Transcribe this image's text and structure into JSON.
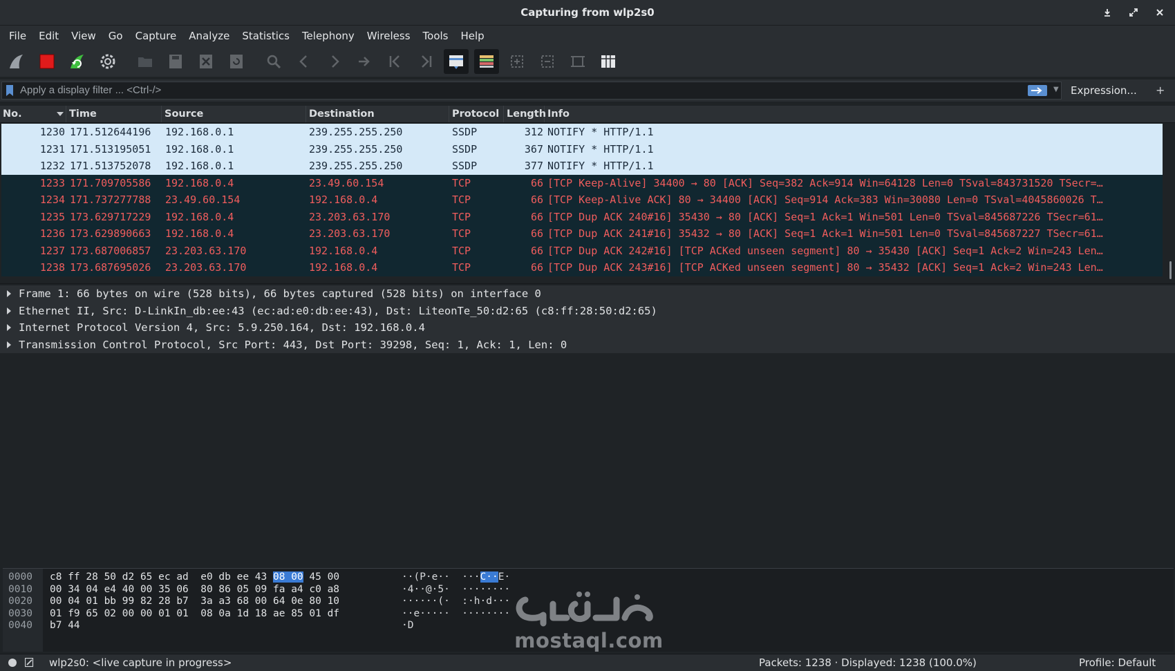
{
  "window": {
    "title": "Capturing from wlp2s0"
  },
  "menu": [
    "File",
    "Edit",
    "View",
    "Go",
    "Capture",
    "Analyze",
    "Statistics",
    "Telephony",
    "Wireless",
    "Tools",
    "Help"
  ],
  "toolbar": [
    {
      "icon": "shark-fin-start-icon"
    },
    {
      "icon": "stop-capture-icon"
    },
    {
      "icon": "restart-capture-icon"
    },
    {
      "icon": "capture-options-gear-icon"
    },
    {
      "icon": "open-file-icon"
    },
    {
      "icon": "save-file-icon"
    },
    {
      "icon": "close-file-icon"
    },
    {
      "icon": "reload-file-icon"
    },
    {
      "icon": "find-packet-icon"
    },
    {
      "icon": "go-back-icon"
    },
    {
      "icon": "go-forward-icon"
    },
    {
      "icon": "go-to-packet-icon"
    },
    {
      "icon": "go-first-icon"
    },
    {
      "icon": "go-last-icon"
    },
    {
      "icon": "autoscroll-icon"
    },
    {
      "icon": "colorize-icon"
    },
    {
      "icon": "zoom-in-icon"
    },
    {
      "icon": "zoom-out-icon"
    },
    {
      "icon": "normal-size-icon"
    },
    {
      "icon": "resize-columns-icon"
    }
  ],
  "filter": {
    "placeholder": "Apply a display filter ... <Ctrl-/>",
    "expression_label": "Expression...",
    "plus_label": "+"
  },
  "columns": [
    "No.",
    "Time",
    "Source",
    "Destination",
    "Protocol",
    "Length",
    "Info"
  ],
  "packets": [
    {
      "no": "1230",
      "time": "171.512644196",
      "src": "192.168.0.1",
      "dst": "239.255.255.250",
      "proto": "SSDP",
      "len": "312",
      "info": "NOTIFY * HTTP/1.1",
      "style": "light"
    },
    {
      "no": "1231",
      "time": "171.513195051",
      "src": "192.168.0.1",
      "dst": "239.255.255.250",
      "proto": "SSDP",
      "len": "367",
      "info": "NOTIFY * HTTP/1.1",
      "style": "light"
    },
    {
      "no": "1232",
      "time": "171.513752078",
      "src": "192.168.0.1",
      "dst": "239.255.255.250",
      "proto": "SSDP",
      "len": "377",
      "info": "NOTIFY * HTTP/1.1",
      "style": "light"
    },
    {
      "no": "1233",
      "time": "171.709705586",
      "src": "192.168.0.4",
      "dst": "23.49.60.154",
      "proto": "TCP",
      "len": "66",
      "info": "[TCP Keep-Alive] 34400 → 80 [ACK] Seq=382 Ack=914 Win=64128 Len=0 TSval=843731520 TSecr=…",
      "style": "dark"
    },
    {
      "no": "1234",
      "time": "171.737277788",
      "src": "23.49.60.154",
      "dst": "192.168.0.4",
      "proto": "TCP",
      "len": "66",
      "info": "[TCP Keep-Alive ACK] 80 → 34400 [ACK] Seq=914 Ack=383 Win=30080 Len=0 TSval=4045860026 T…",
      "style": "dark"
    },
    {
      "no": "1235",
      "time": "173.629717229",
      "src": "192.168.0.4",
      "dst": "23.203.63.170",
      "proto": "TCP",
      "len": "66",
      "info": "[TCP Dup ACK 240#16] 35430 → 80 [ACK] Seq=1 Ack=1 Win=501 Len=0 TSval=845687226 TSecr=61…",
      "style": "dark"
    },
    {
      "no": "1236",
      "time": "173.629890663",
      "src": "192.168.0.4",
      "dst": "23.203.63.170",
      "proto": "TCP",
      "len": "66",
      "info": "[TCP Dup ACK 241#16] 35432 → 80 [ACK] Seq=1 Ack=1 Win=501 Len=0 TSval=845687227 TSecr=61…",
      "style": "dark"
    },
    {
      "no": "1237",
      "time": "173.687006857",
      "src": "23.203.63.170",
      "dst": "192.168.0.4",
      "proto": "TCP",
      "len": "66",
      "info": "[TCP Dup ACK 242#16] [TCP ACKed unseen segment] 80 → 35430 [ACK] Seq=1 Ack=2 Win=243 Len…",
      "style": "dark"
    },
    {
      "no": "1238",
      "time": "173.687695026",
      "src": "23.203.63.170",
      "dst": "192.168.0.4",
      "proto": "TCP",
      "len": "66",
      "info": "[TCP Dup ACK 243#16] [TCP ACKed unseen segment] 80 → 35432 [ACK] Seq=1 Ack=2 Win=243 Len…",
      "style": "dark"
    }
  ],
  "details": [
    "Frame 1: 66 bytes on wire (528 bits), 66 bytes captured (528 bits) on interface 0",
    "Ethernet II, Src: D-LinkIn_db:ee:43 (ec:ad:e0:db:ee:43), Dst: LiteonTe_50:d2:65 (c8:ff:28:50:d2:65)",
    "Internet Protocol Version 4, Src: 5.9.250.164, Dst: 192.168.0.4",
    "Transmission Control Protocol, Src Port: 443, Dst Port: 39298, Seq: 1, Ack: 1, Len: 0"
  ],
  "bytes": [
    {
      "offset": "0000",
      "hex_a": "c8 ff 28 50 d2 65 ec ad  e0 db ee 43 ",
      "hex_hl": "08 00",
      "hex_b": " 45 00",
      "ascii_a": "··(P·e··  ···",
      "ascii_hl": "C··",
      "ascii_b": "E·"
    },
    {
      "offset": "0010",
      "hex_a": "00 34 04 e4 40 00 35 06  80 86 05 09 fa a4 c0 a8",
      "hex_hl": "",
      "hex_b": "",
      "ascii_a": "·4··@·5·  ········",
      "ascii_hl": "",
      "ascii_b": ""
    },
    {
      "offset": "0020",
      "hex_a": "00 04 01 bb 99 82 28 b7  3a a3 68 00 64 0e 80 10",
      "hex_hl": "",
      "hex_b": "",
      "ascii_a": "······(·  :·h·d···",
      "ascii_hl": "",
      "ascii_b": ""
    },
    {
      "offset": "0030",
      "hex_a": "01 f9 65 02 00 00 01 01  08 0a 1d 18 ae 85 01 df",
      "hex_hl": "",
      "hex_b": "",
      "ascii_a": "··e·····  ········",
      "ascii_hl": "",
      "ascii_b": ""
    },
    {
      "offset": "0040",
      "hex_a": "b7 44",
      "hex_hl": "",
      "hex_b": "",
      "ascii_a": "·D",
      "ascii_hl": "",
      "ascii_b": ""
    }
  ],
  "watermark": {
    "text": "mostaql.com",
    "logo_text": "مستقل"
  },
  "status": {
    "capture": "wlp2s0: <live capture in progress>",
    "packets": "Packets: 1238 · Displayed: 1238 (100.0%)",
    "profile": "Profile: Default"
  },
  "colors": {
    "ssdp_row_bg": "#d5e9f8",
    "tcp_bad_row_bg": "#112730",
    "tcp_bad_row_fg": "#f05d5d",
    "highlight": "#3a7bd5"
  }
}
